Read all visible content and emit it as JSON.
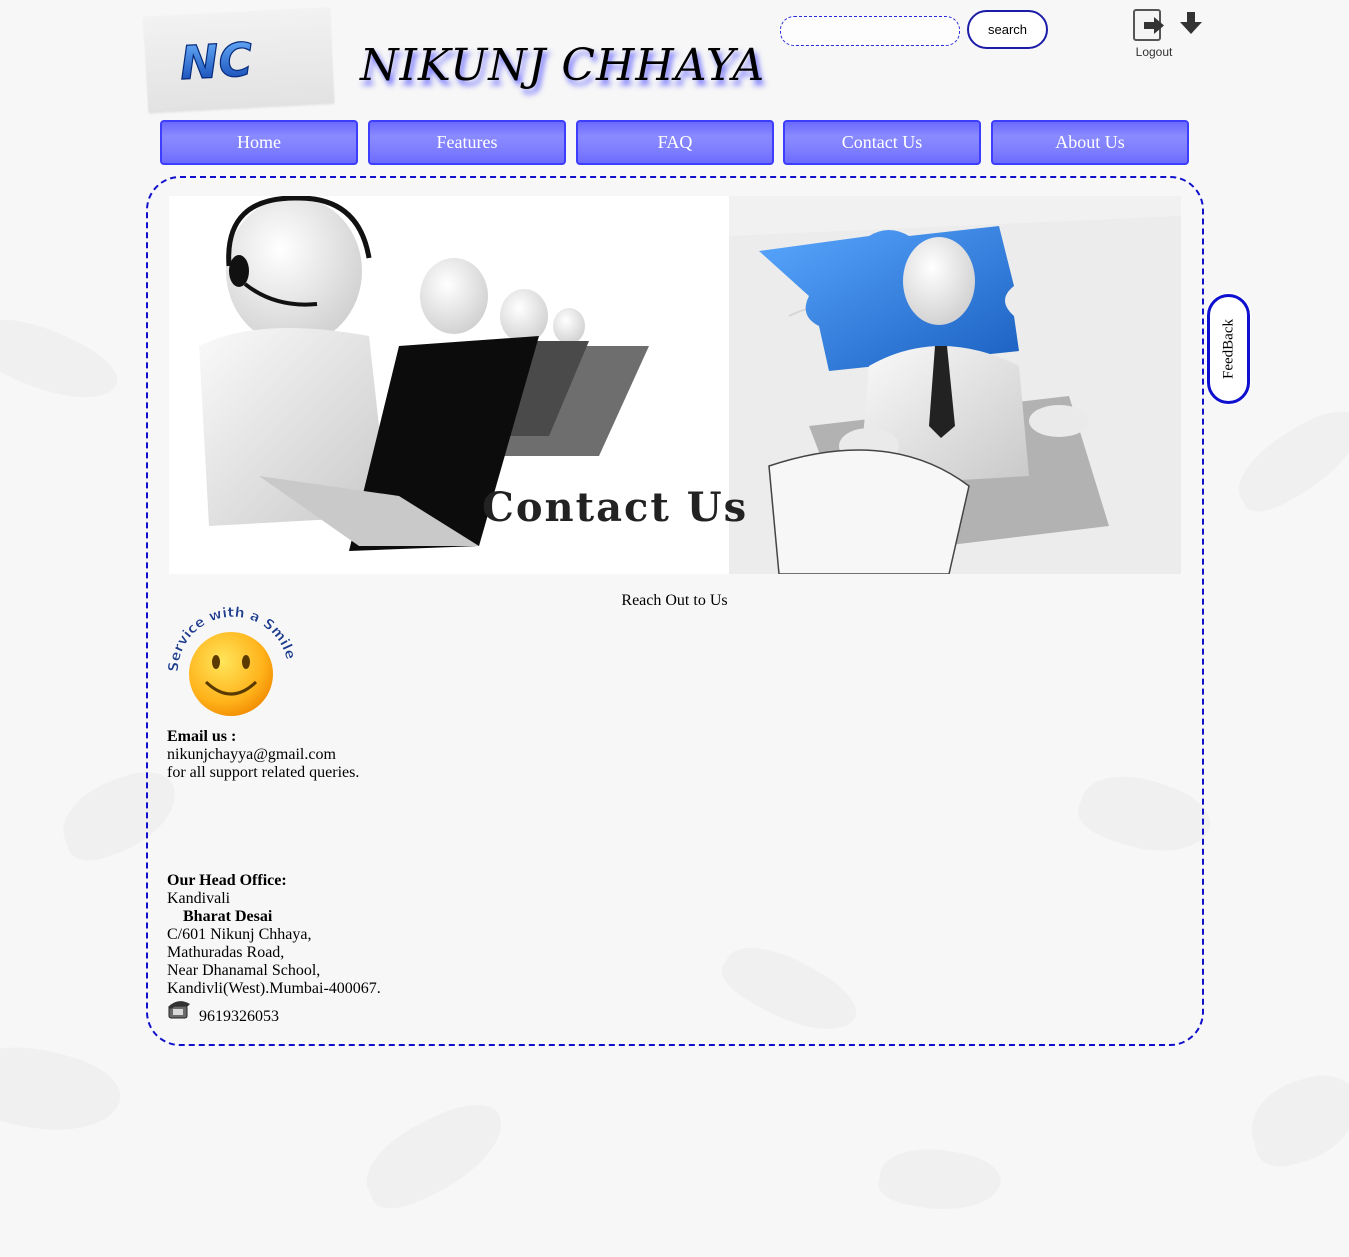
{
  "header": {
    "logo_text": "NC",
    "site_title": "NIKUNJ CHHAYA",
    "search_placeholder": "",
    "search_label": "search",
    "logout_label": "Logout"
  },
  "nav": [
    {
      "label": "Home"
    },
    {
      "label": "Features"
    },
    {
      "label": "FAQ"
    },
    {
      "label": "Contact Us"
    },
    {
      "label": "About Us"
    }
  ],
  "banner": {
    "title": "Contact Us"
  },
  "content": {
    "reach_heading": "Reach Out to Us",
    "smiley_badge": "Service with a Smile",
    "email_heading": "Email us :",
    "email_address": "nikunjchayya@gmail.com",
    "email_note": "for all support related queries.",
    "office_heading": "Our Head Office:",
    "office_area": "Kandivali",
    "office_person": "Bharat Desai",
    "address_line1": "C/601 Nikunj Chhaya,",
    "address_line2": "Mathuradas Road,",
    "address_line3": "Near Dhanamal School,",
    "address_line4": "Kandivli(West).Mumbai-400067.",
    "phone": "9619326053"
  },
  "feedback": {
    "label": "FeedBack"
  },
  "colors": {
    "nav_fill": "#8080ff",
    "nav_border": "#3d3dff",
    "frame_border": "#1010cc",
    "puzzle_blue": "#2f7fe0"
  },
  "icons": [
    "logout-icon",
    "download-arrow-icon",
    "phone-icon",
    "smiley-icon"
  ]
}
